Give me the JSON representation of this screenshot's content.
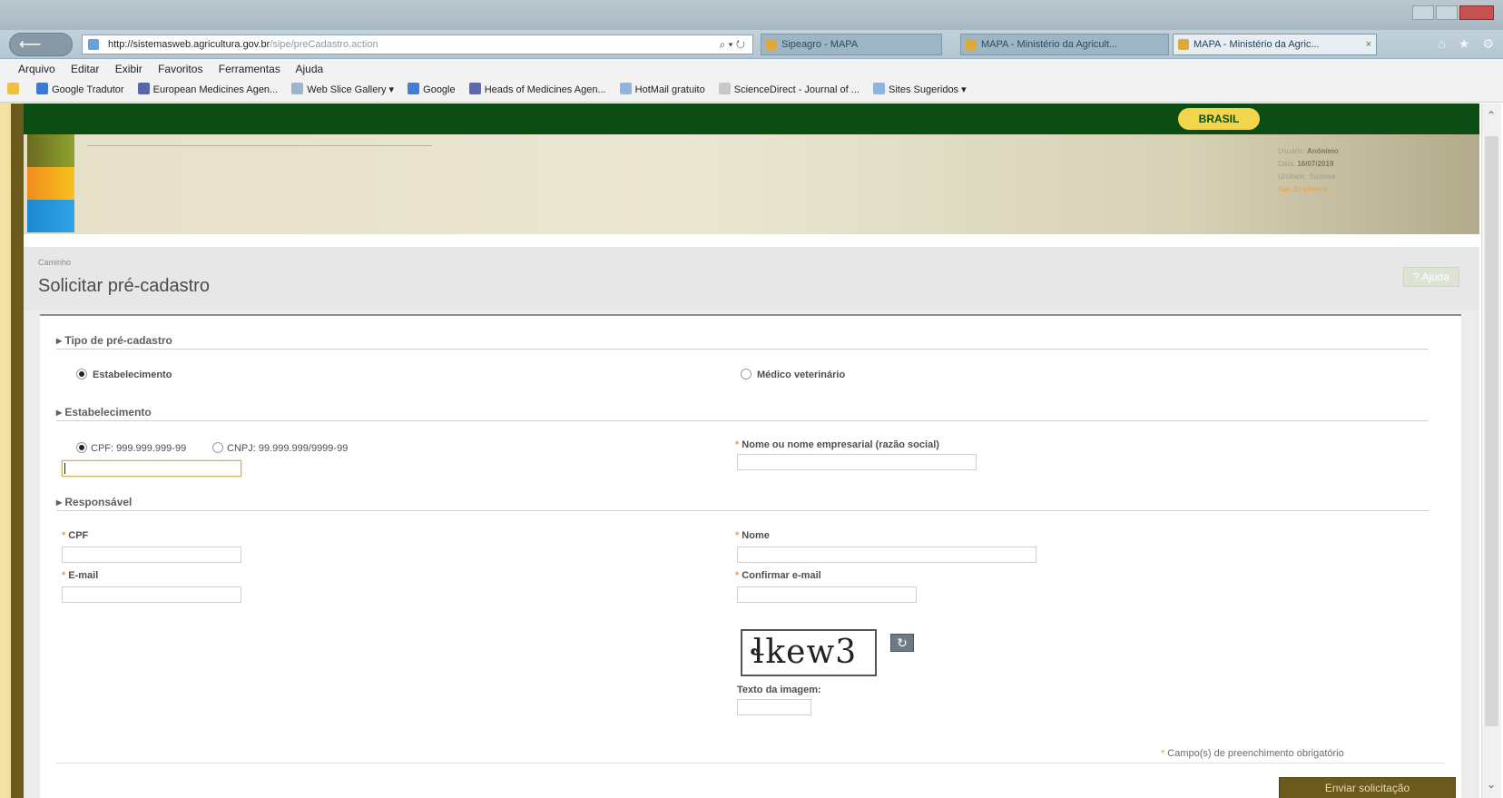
{
  "browser": {
    "address": {
      "domain": "http://sistemasweb.agricultura.gov.br",
      "path": "/sipe/preCadastro.action",
      "tools": "⌕ ▾ ↻"
    },
    "tabs": [
      {
        "label": "Sipeagro - MAPA",
        "active": false
      },
      {
        "label": "MAPA - Ministério da Agricult...",
        "active": false
      },
      {
        "label": "MAPA - Ministério da Agric...",
        "active": true
      }
    ],
    "menu": [
      "Arquivo",
      "Editar",
      "Exibir",
      "Favoritos",
      "Ferramentas",
      "Ajuda"
    ],
    "favorites": [
      {
        "label": "Google Tradutor",
        "color": "#3b78d8"
      },
      {
        "label": "European Medicines Agen...",
        "color": "#5566aa"
      },
      {
        "label": "Web Slice Gallery ▾",
        "color": "#9bb5d0"
      },
      {
        "label": "Google",
        "color": "#3f7fd6"
      },
      {
        "label": "Heads of Medicines Agen...",
        "color": "#5a6ab0"
      },
      {
        "label": "HotMail gratuito",
        "color": "#8fb4dd"
      },
      {
        "label": "ScienceDirect - Journal of ...",
        "color": "#c7c7c7"
      },
      {
        "label": "Sites Sugeridos ▾",
        "color": "#8fb4dd"
      }
    ]
  },
  "header": {
    "brasil": "BRASIL",
    "user": {
      "user_label": "Usuário:",
      "user_value": "Anônimo",
      "date_label": "Data:",
      "date_value": "16/07/2019",
      "unit": "Unidade: Sistema",
      "link": "Sair do sistema"
    }
  },
  "page": {
    "breadcrumb": "Caminho",
    "title": "Solicitar pré-cadastro",
    "help": "? Ajuda"
  },
  "form": {
    "section_tipo": "▸ Tipo de pré-cadastro",
    "opt_estabelecimento": "Estabelecimento",
    "opt_medico": "Médico veterinário",
    "section_estab": "▸ Estabelecimento",
    "cpf_option": "CPF: 999.999.999-99",
    "cnpj_option": "CNPJ: 99.999.999/9999-99",
    "nome_empresarial": "Nome ou nome empresarial (razão social)",
    "section_resp": "▸ Responsável",
    "cpf": "CPF",
    "nome": "Nome",
    "email": "E-mail",
    "confirm_email": "Confirmar e-mail",
    "captcha_text": "ɬkew3",
    "captcha_label": "Texto da imagem:",
    "required_note": "Campo(s) de preenchimento obrigatório",
    "submit": "Enviar solicitação"
  },
  "colors": {
    "green": "#0b4d13",
    "gold": "#f2d54a",
    "brown": "#6b5a1c"
  }
}
